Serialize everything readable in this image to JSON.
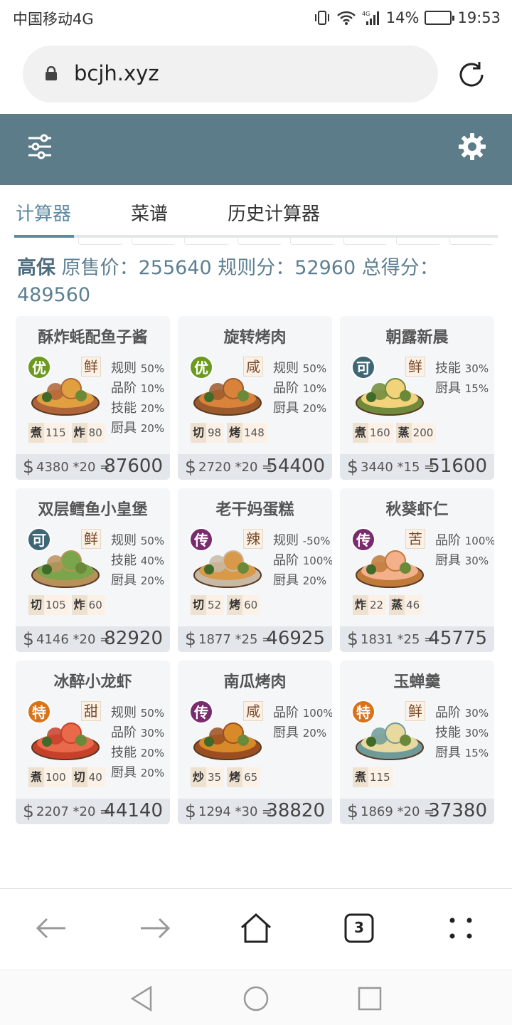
{
  "status_bar": {
    "carrier": "中国移动4G",
    "battery": "14%",
    "time": "19:53",
    "network": "4G"
  },
  "browser": {
    "url": "bcjh.xyz",
    "tab_count": "3"
  },
  "tabs": [
    {
      "label": "计算器",
      "active": true
    },
    {
      "label": "菜谱",
      "active": false
    },
    {
      "label": "历史计算器",
      "active": false
    }
  ],
  "summary": {
    "title": "高保",
    "orig_label": "原售价：",
    "orig_value": "255640",
    "rule_label": "规则分：",
    "rule_value": "52960",
    "total_label": "总得分：",
    "total_value": "489560"
  },
  "cards": [
    {
      "name": "酥炸蚝配鱼子酱",
      "rarity": "优",
      "rarity_color": "#6b9a1f",
      "flavor": "鲜",
      "rules": [
        [
          "规则",
          "50%"
        ],
        [
          "品阶",
          "10%"
        ],
        [
          "技能",
          "20%"
        ],
        [
          "厨具",
          "20%"
        ]
      ],
      "skills": [
        [
          "煮",
          "115"
        ],
        [
          "炸",
          "80"
        ]
      ],
      "price": "4380 *20",
      "total": "87600"
    },
    {
      "name": "旋转烤肉",
      "rarity": "优",
      "rarity_color": "#6b9a1f",
      "flavor": "咸",
      "rules": [
        [
          "规则",
          "50%"
        ],
        [
          "品阶",
          "10%"
        ],
        [
          "厨具",
          "20%"
        ]
      ],
      "skills": [
        [
          "切",
          "98"
        ],
        [
          "烤",
          "148"
        ]
      ],
      "price": "2720 *20",
      "total": "54400"
    },
    {
      "name": "朝露新晨",
      "rarity": "可",
      "rarity_color": "#3e6674",
      "flavor": "鲜",
      "rules": [
        [
          "技能",
          "30%"
        ],
        [
          "厨具",
          "15%"
        ]
      ],
      "skills": [
        [
          "煮",
          "160"
        ],
        [
          "蒸",
          "200"
        ]
      ],
      "price": "3440 *15",
      "total": "51600"
    },
    {
      "name": "双层鳕鱼小皇堡",
      "rarity": "可",
      "rarity_color": "#3e6674",
      "flavor": "鲜",
      "rules": [
        [
          "规则",
          "50%"
        ],
        [
          "技能",
          "40%"
        ],
        [
          "厨具",
          "20%"
        ]
      ],
      "skills": [
        [
          "切",
          "105"
        ],
        [
          "炸",
          "60"
        ]
      ],
      "price": "4146 *20",
      "total": "82920"
    },
    {
      "name": "老干妈蛋糕",
      "rarity": "传",
      "rarity_color": "#7a2b6e",
      "flavor": "辣",
      "rules": [
        [
          "规则",
          "-50%"
        ],
        [
          "品阶",
          "100%"
        ],
        [
          "厨具",
          "20%"
        ]
      ],
      "skills": [
        [
          "切",
          "52"
        ],
        [
          "烤",
          "60"
        ]
      ],
      "price": "1877 *25",
      "total": "46925"
    },
    {
      "name": "秋葵虾仁",
      "rarity": "传",
      "rarity_color": "#7a2b6e",
      "flavor": "苦",
      "rules": [
        [
          "品阶",
          "100%"
        ],
        [
          "厨具",
          "30%"
        ]
      ],
      "skills": [
        [
          "炸",
          "22"
        ],
        [
          "蒸",
          "46"
        ]
      ],
      "price": "1831 *25",
      "total": "45775"
    },
    {
      "name": "冰醉小龙虾",
      "rarity": "特",
      "rarity_color": "#d8731a",
      "flavor": "甜",
      "rules": [
        [
          "规则",
          "50%"
        ],
        [
          "品阶",
          "30%"
        ],
        [
          "技能",
          "20%"
        ],
        [
          "厨具",
          "20%"
        ]
      ],
      "skills": [
        [
          "煮",
          "100"
        ],
        [
          "切",
          "40"
        ]
      ],
      "price": "2207 *20",
      "total": "44140"
    },
    {
      "name": "南瓜烤肉",
      "rarity": "传",
      "rarity_color": "#7a2b6e",
      "flavor": "咸",
      "rules": [
        [
          "品阶",
          "100%"
        ],
        [
          "厨具",
          "20%"
        ]
      ],
      "skills": [
        [
          "炒",
          "35"
        ],
        [
          "烤",
          "65"
        ]
      ],
      "price": "1294 *30",
      "total": "38820"
    },
    {
      "name": "玉蝉羹",
      "rarity": "特",
      "rarity_color": "#d8731a",
      "flavor": "鲜",
      "rules": [
        [
          "品阶",
          "30%"
        ],
        [
          "技能",
          "30%"
        ],
        [
          "厨具",
          "15%"
        ]
      ],
      "skills": [
        [
          "煮",
          "115"
        ]
      ],
      "price": "1869 *20",
      "total": "37380"
    }
  ]
}
